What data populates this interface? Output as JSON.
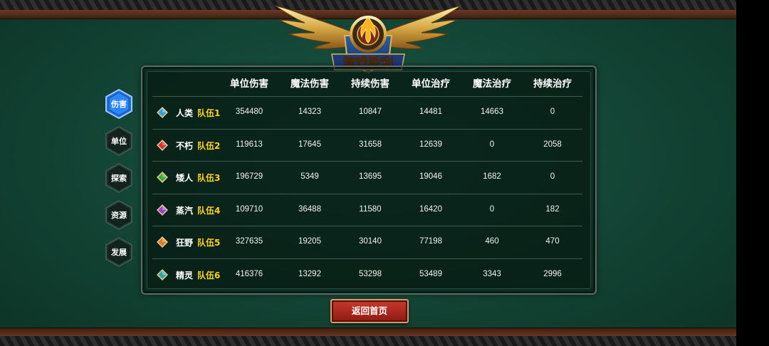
{
  "title_banner": "游戏胜利",
  "headers": [
    "单位伤害",
    "魔法伤害",
    "持续伤害",
    "单位治疗",
    "魔法治疗",
    "持续治疗"
  ],
  "rows": [
    {
      "race": "人类",
      "team": "队伍1",
      "gem_color": "#2f9ed8",
      "values": [
        "354480",
        "14323",
        "10847",
        "14481",
        "14663",
        "0"
      ]
    },
    {
      "race": "不朽",
      "team": "队伍2",
      "gem_color": "#d8322a",
      "values": [
        "119613",
        "17645",
        "31658",
        "12639",
        "0",
        "2058"
      ]
    },
    {
      "race": "矮人",
      "team": "队伍3",
      "gem_color": "#3cae2f",
      "values": [
        "196729",
        "5349",
        "13695",
        "19046",
        "1682",
        "0"
      ]
    },
    {
      "race": "蒸汽",
      "team": "队伍4",
      "gem_color": "#9a3ed0",
      "values": [
        "109710",
        "36488",
        "11580",
        "16420",
        "0",
        "182"
      ]
    },
    {
      "race": "狂野",
      "team": "队伍5",
      "gem_color": "#e07a1c",
      "values": [
        "327635",
        "19205",
        "30140",
        "77198",
        "460",
        "470"
      ]
    },
    {
      "race": "精灵",
      "team": "队伍6",
      "gem_color": "#27a998",
      "values": [
        "416376",
        "13292",
        "53298",
        "53489",
        "3343",
        "2996"
      ]
    }
  ],
  "side_tabs": [
    {
      "label": "伤害",
      "active": true
    },
    {
      "label": "单位",
      "active": false
    },
    {
      "label": "探索",
      "active": false
    },
    {
      "label": "资源",
      "active": false
    },
    {
      "label": "发展",
      "active": false
    }
  ],
  "home_button": "返回首页",
  "colors": {
    "accent_team": "#ffd21c",
    "active_tab": "#1e6fe0",
    "button_red": "#b12a20"
  }
}
